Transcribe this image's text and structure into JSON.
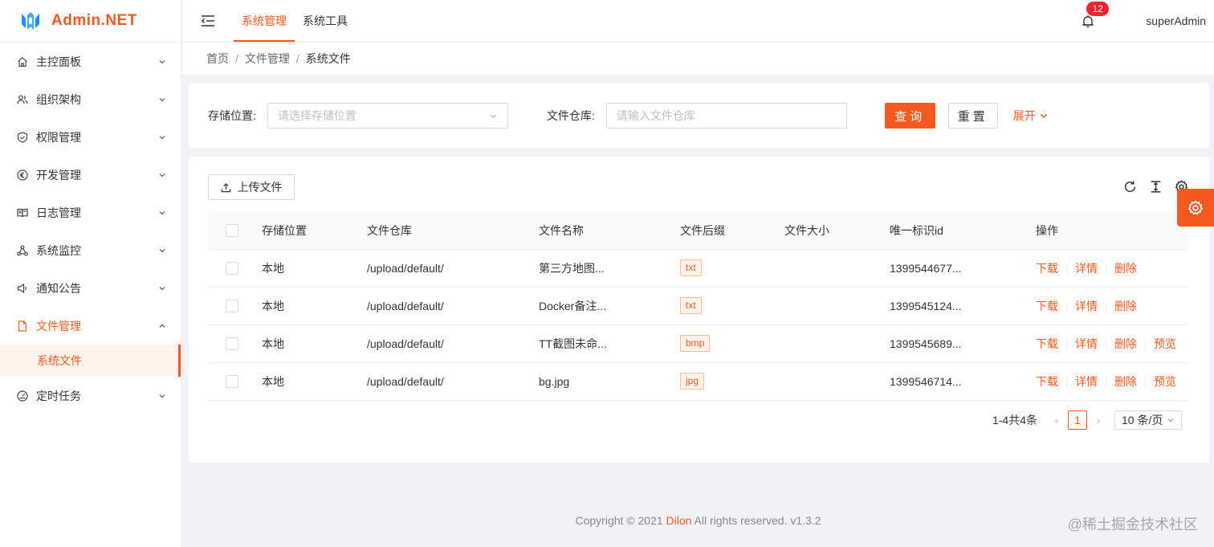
{
  "app": {
    "title": "Admin.NET"
  },
  "sidebar": {
    "items": [
      {
        "label": "主控面板",
        "icon": "home-icon"
      },
      {
        "label": "组织架构",
        "icon": "team-icon"
      },
      {
        "label": "权限管理",
        "icon": "shield-icon"
      },
      {
        "label": "开发管理",
        "icon": "euro-icon"
      },
      {
        "label": "日志管理",
        "icon": "book-icon"
      },
      {
        "label": "系统监控",
        "icon": "cluster-icon"
      },
      {
        "label": "通知公告",
        "icon": "sound-icon"
      },
      {
        "label": "文件管理",
        "icon": "file-icon"
      },
      {
        "label": "定时任务",
        "icon": "dashboard-icon"
      }
    ],
    "submenu_active": "系统文件"
  },
  "header": {
    "tabs": [
      "系统管理",
      "系统工具"
    ],
    "active_tab": "系统管理",
    "notification_count": "12",
    "user": "superAdmin"
  },
  "breadcrumb": [
    "首页",
    "文件管理",
    "系统文件"
  ],
  "search": {
    "storage_label": "存储位置:",
    "storage_placeholder": "请选择存储位置",
    "repo_label": "文件仓库:",
    "repo_placeholder": "请输入文件仓库",
    "query_button": "查询",
    "reset_button": "重置",
    "expand_link": "展开"
  },
  "table": {
    "upload_button": "上传文件",
    "columns": [
      "存储位置",
      "文件仓库",
      "文件名称",
      "文件后缀",
      "文件大小",
      "唯一标识id",
      "操作"
    ],
    "rows": [
      {
        "storage": "本地",
        "repo": "/upload/default/",
        "name": "第三方地图...",
        "suffix": "txt",
        "size": "",
        "id": "1399544677...",
        "actions": [
          "下载",
          "详情",
          "删除"
        ]
      },
      {
        "storage": "本地",
        "repo": "/upload/default/",
        "name": "Docker备注...",
        "suffix": "txt",
        "size": "",
        "id": "1399545124...",
        "actions": [
          "下载",
          "详情",
          "删除"
        ]
      },
      {
        "storage": "本地",
        "repo": "/upload/default/",
        "name": "TT截图未命...",
        "suffix": "bmp",
        "size": "",
        "id": "1399545689...",
        "actions": [
          "下载",
          "详情",
          "删除",
          "预览"
        ]
      },
      {
        "storage": "本地",
        "repo": "/upload/default/",
        "name": "bg.jpg",
        "suffix": "jpg",
        "size": "",
        "id": "1399546714...",
        "actions": [
          "下载",
          "详情",
          "删除",
          "预览"
        ]
      }
    ]
  },
  "pagination": {
    "total_text": "1-4共4条",
    "current_page": "1",
    "page_size": "10 条/页"
  },
  "footer": {
    "prefix": "Copyright © 2021 ",
    "brand": "Dilon",
    "suffix": " All rights reserved. v1.3.2"
  },
  "watermark": "@稀土掘金技术社区",
  "colors": {
    "accent": "#f5591f",
    "badge": "#f5222d"
  }
}
